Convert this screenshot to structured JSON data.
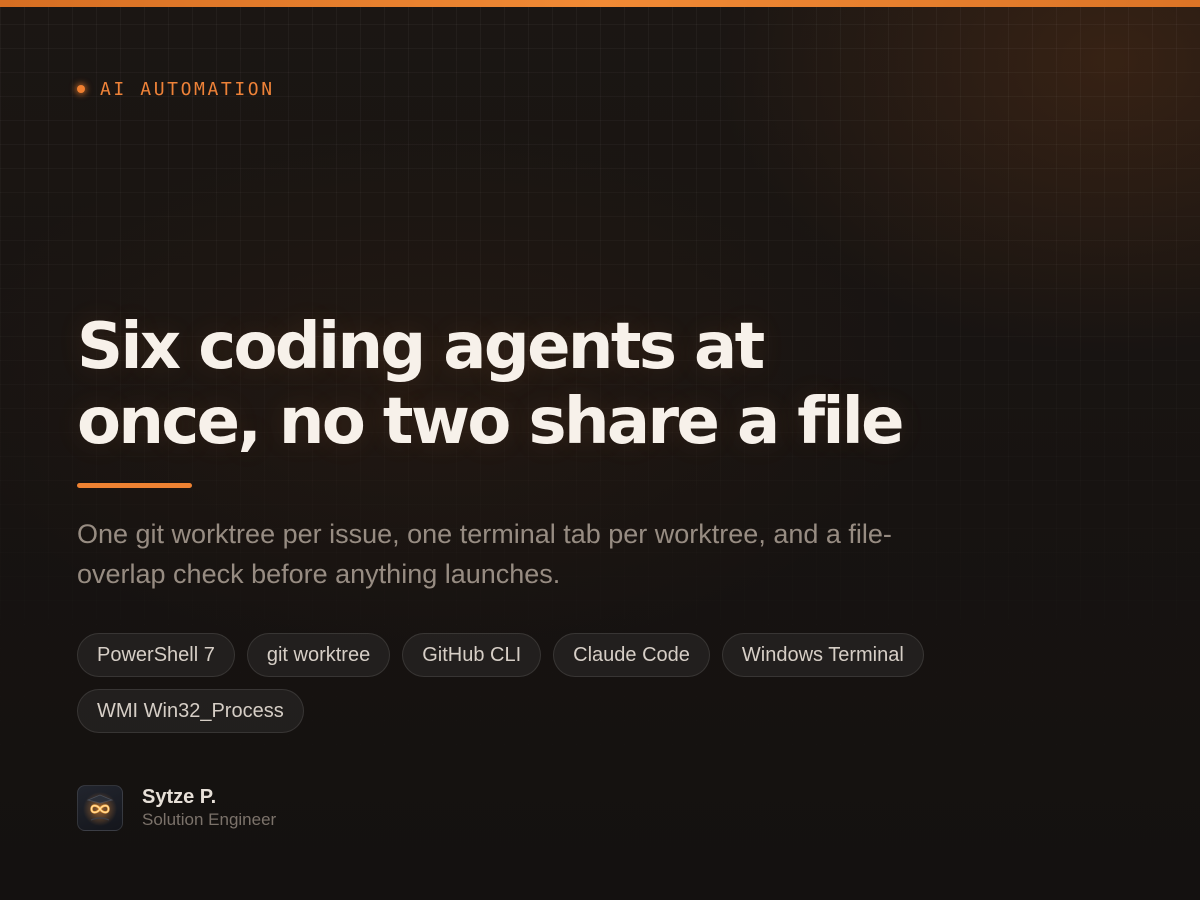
{
  "eyebrow": {
    "icon": "orange-dot-icon",
    "label": "AI AUTOMATION"
  },
  "headline": {
    "line1": "Six coding agents at",
    "line2": "once, no two share a file"
  },
  "subtitle": "One git worktree per issue, one terminal tab per worktree, and a file-overlap check before anything launches.",
  "tags": [
    "PowerShell 7",
    "git worktree",
    "GitHub CLI",
    "Claude Code",
    "Windows Terminal",
    "WMI Win32_Process"
  ],
  "author": {
    "avatar_icon": "infinity-logo-icon",
    "name": "Sytze P.",
    "role": "Solution Engineer"
  },
  "colors": {
    "accent": "#ee8232",
    "background": "#161210",
    "headline": "#f7f1ea",
    "body_text": "#978c82"
  }
}
